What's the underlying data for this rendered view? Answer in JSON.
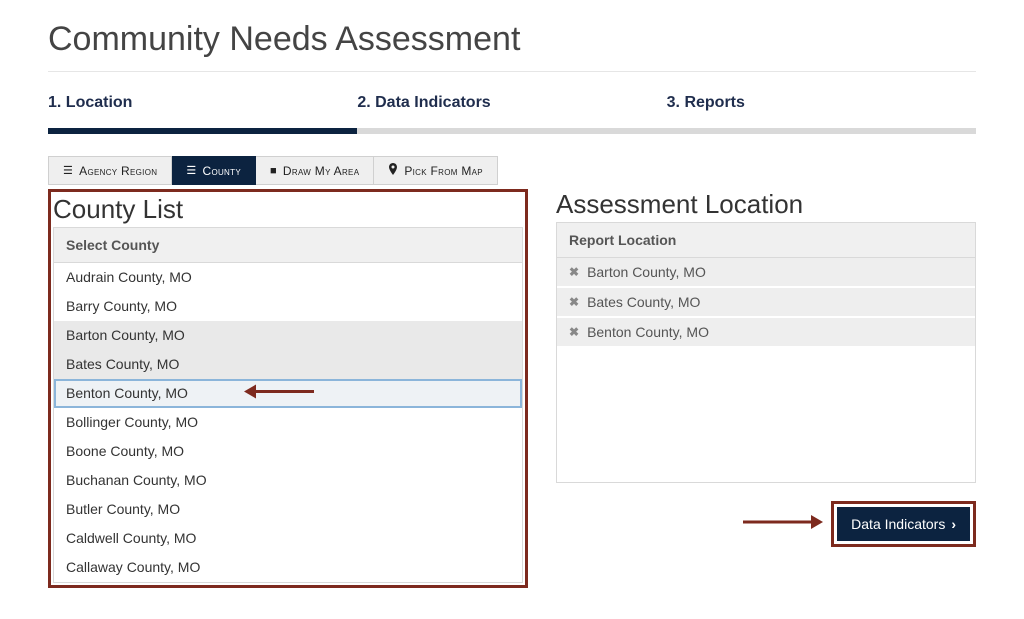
{
  "page": {
    "title": "Community Needs Assessment"
  },
  "steps": [
    {
      "label": "1. Location",
      "active": true
    },
    {
      "label": "2. Data Indicators",
      "active": false
    },
    {
      "label": "3. Reports",
      "active": false
    }
  ],
  "tabs": {
    "agency_region": "Agency Region",
    "county": "County",
    "draw_my_area": "Draw My Area",
    "pick_from_map": "Pick From Map"
  },
  "county_panel": {
    "title": "County List",
    "header": "Select County",
    "items": [
      {
        "label": "Audrain County, MO",
        "state": ""
      },
      {
        "label": "Barry County, MO",
        "state": ""
      },
      {
        "label": "Barton County, MO",
        "state": "selected-grey"
      },
      {
        "label": "Bates County, MO",
        "state": "selected-grey"
      },
      {
        "label": "Benton County, MO",
        "state": "highlighted"
      },
      {
        "label": "Bollinger County, MO",
        "state": ""
      },
      {
        "label": "Boone County, MO",
        "state": ""
      },
      {
        "label": "Buchanan County, MO",
        "state": ""
      },
      {
        "label": "Butler County, MO",
        "state": ""
      },
      {
        "label": "Caldwell County, MO",
        "state": ""
      },
      {
        "label": "Callaway County, MO",
        "state": ""
      }
    ]
  },
  "assessment_panel": {
    "title": "Assessment Location",
    "header": "Report Location",
    "items": [
      {
        "label": "Barton County, MO"
      },
      {
        "label": "Bates County, MO"
      },
      {
        "label": "Benton County, MO"
      }
    ]
  },
  "footer": {
    "next_button": "Data Indicators"
  },
  "colors": {
    "navy": "#0c2340",
    "highlight_frame": "#7d2a1e"
  }
}
